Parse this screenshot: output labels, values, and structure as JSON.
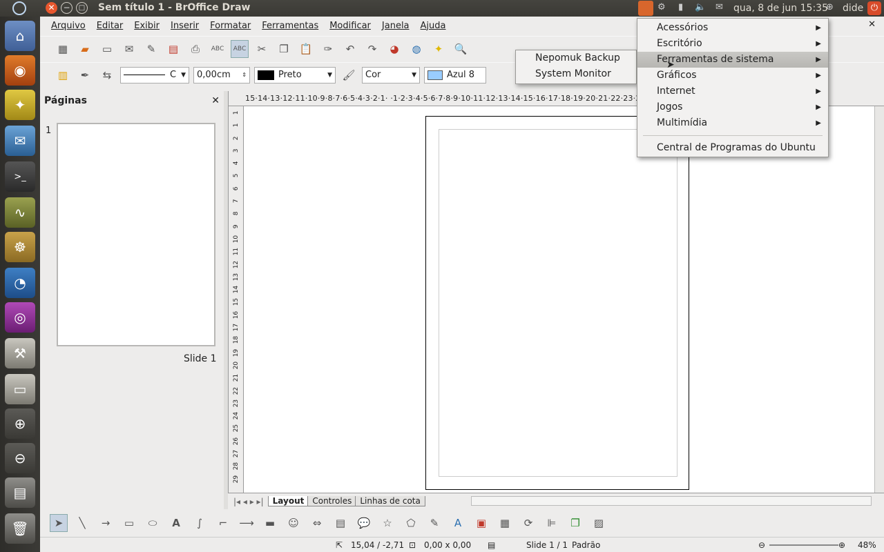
{
  "topbar": {
    "window_title": "Sem título 1 - BrOffice Draw",
    "clock": "qua, 8 de jun 15:35",
    "user": "dide"
  },
  "launcher": {
    "items": [
      "home-folder-icon",
      "firefox-icon",
      "thunderbird-bird-icon",
      "thunderbird-mail-icon",
      "terminal-icon",
      "system-monitor-icon",
      "ubuntu-software-icon",
      "gnome-wolf-icon",
      "network-globe-icon",
      "settings-tools-icon",
      "window-icon",
      "zoom-in-icon",
      "zoom-out-icon",
      "drive-icon",
      "trash-icon"
    ]
  },
  "menubar": {
    "items": [
      "Arquivo",
      "Editar",
      "Exibir",
      "Inserir",
      "Formatar",
      "Ferramentas",
      "Modificar",
      "Janela",
      "Ajuda"
    ]
  },
  "linebar": {
    "line_style": "C",
    "line_width": "0,00cm",
    "line_color": "Preto",
    "line_color_hex": "#000000",
    "area_style": "Cor",
    "area_color": "Azul 8",
    "area_color_hex": "#99ccff"
  },
  "pages_panel": {
    "title": "Páginas",
    "page_number": "1",
    "slide_label": "Slide 1"
  },
  "ruler": {
    "horizontal": "15·14·13·12·11·10·9·8·7·6·5·4·3·2·1· ·1·2·3·4·5·6·7·8·9·10·11·12·13·14·15·16·17·18·19·20·21·22·23·24·25·26·27·28·29·30·31·32·33·34·",
    "vertical": [
      "1",
      "1",
      "2",
      "3",
      "4",
      "5",
      "6",
      "7",
      "8",
      "9",
      "10",
      "11",
      "12",
      "13",
      "14",
      "15",
      "16",
      "17",
      "18",
      "19",
      "20",
      "21",
      "22",
      "23",
      "24",
      "25",
      "26",
      "27",
      "28",
      "29"
    ]
  },
  "tabs": [
    "Layout",
    "Controles",
    "Linhas de cota"
  ],
  "statusbar": {
    "position": "15,04 / -2,71",
    "size": "0,00 x 0,00",
    "slide": "Slide 1 / 1",
    "layout": "Padrão",
    "zoom": "48%"
  },
  "app_menu": {
    "items": [
      {
        "label": "Acessórios",
        "has_sub": true
      },
      {
        "label": "Escritório",
        "has_sub": true
      },
      {
        "label": "Ferramentas de sistema",
        "has_sub": true,
        "highlighted": true
      },
      {
        "label": "Gráficos",
        "has_sub": true
      },
      {
        "label": "Internet",
        "has_sub": true
      },
      {
        "label": "Jogos",
        "has_sub": true
      },
      {
        "label": "Multimídia",
        "has_sub": true
      }
    ],
    "footer": "Central de Programas do Ubuntu"
  },
  "submenu": {
    "items": [
      "Nepomuk Backup",
      "System Monitor"
    ]
  }
}
